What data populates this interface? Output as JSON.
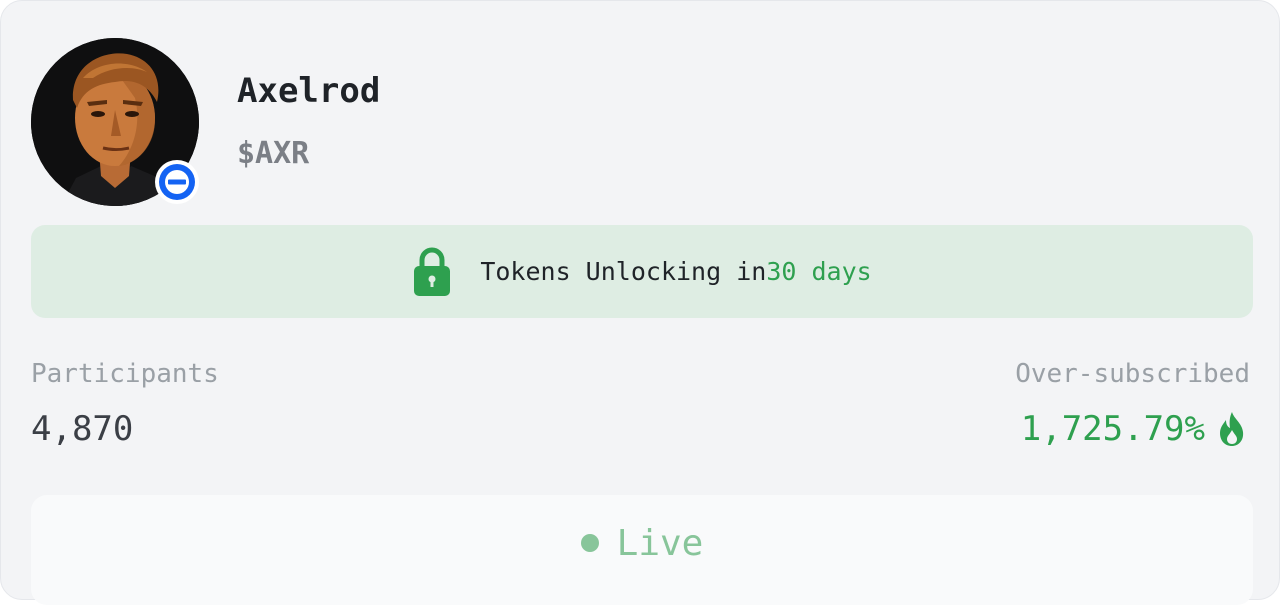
{
  "token": {
    "name": "Axelrod",
    "ticker": "$AXR",
    "avatar_icon": "portrait-avatar",
    "badge_icon": "chain-badge-icon"
  },
  "unlock": {
    "icon": "lock-icon",
    "text": "Tokens Unlocking in ",
    "days": "30 days"
  },
  "stats": {
    "participants_label": "Participants",
    "participants_value": "4,870",
    "oversubscribed_label": "Over-subscribed",
    "oversubscribed_value": "1,725.79%",
    "oversubscribed_icon": "flame-icon"
  },
  "status": {
    "label": "Live"
  },
  "colors": {
    "accent_green": "#2ea04f",
    "banner_bg": "#deede3",
    "badge_blue": "#1463f3",
    "live_green": "#88c59a"
  }
}
